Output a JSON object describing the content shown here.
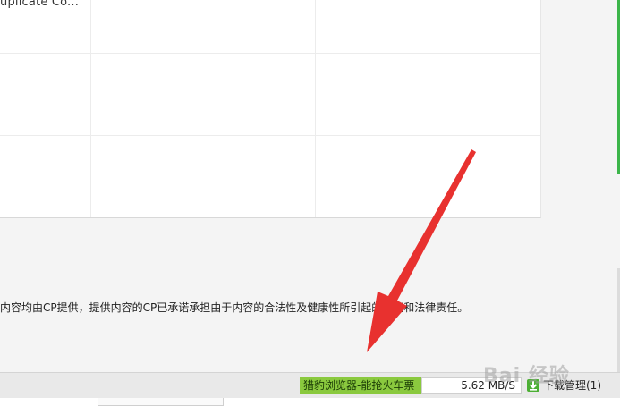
{
  "table": {
    "cell_truncated": "uplicate Co..."
  },
  "disclaimer": {
    "text": "内容均由CP提供，提供内容的CP已承诺承担由于内容的合法性及健康性所引起的争议和法律责任。"
  },
  "statusbar": {
    "promo": "猎豹浏览器-能抢火车票",
    "speed": "5.62 MB/S",
    "download_manager": "下载管理(1)"
  },
  "watermark": {
    "text": "Bai 经验"
  },
  "colors": {
    "promo_bg": "#8ac93e",
    "arrow": "#e8312f",
    "accent_green": "#3cb54a"
  }
}
